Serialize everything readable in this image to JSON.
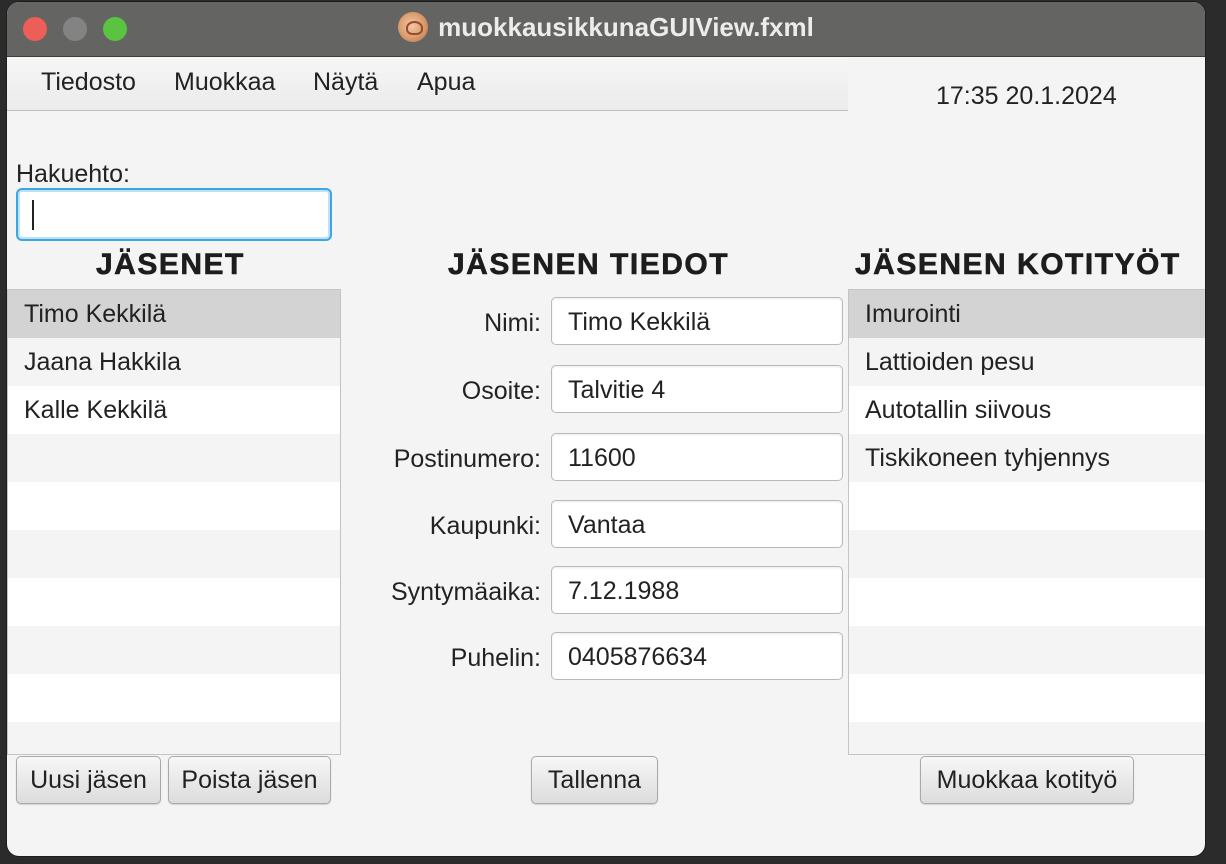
{
  "window": {
    "title": "muokkausikkunaGUIView.fxml",
    "app_icon": "app-icon"
  },
  "menu": {
    "items": [
      "Tiedosto",
      "Muokkaa",
      "Näytä",
      "Apua"
    ]
  },
  "clock": "17:35 20.1.2024",
  "search": {
    "label": "Hakuehto:",
    "value": "",
    "placeholder": ""
  },
  "members": {
    "heading": "JÄSENET",
    "items": [
      "Timo Kekkilä",
      "Jaana Hakkila",
      "Kalle Kekkilä"
    ],
    "selected_index": 0
  },
  "details": {
    "heading": "JÄSENEN TIEDOT",
    "fields": [
      {
        "label": "Nimi:",
        "value": "Timo Kekkilä"
      },
      {
        "label": "Osoite:",
        "value": "Talvitie 4"
      },
      {
        "label": "Postinumero:",
        "value": "11600"
      },
      {
        "label": "Kaupunki:",
        "value": "Vantaa"
      },
      {
        "label": "Syntymäaika:",
        "value": "7.12.1988"
      },
      {
        "label": "Puhelin:",
        "value": "0405876634"
      }
    ]
  },
  "chores": {
    "heading": "JÄSENEN KOTITYÖT",
    "items": [
      "Imurointi",
      "Lattioiden pesu",
      "Autotallin siivous",
      "Tiskikoneen tyhjennys"
    ],
    "selected_index": 0
  },
  "buttons": {
    "new_member": "Uusi jäsen",
    "delete_member": "Poista jäsen",
    "save": "Tallenna",
    "edit_chore": "Muokkaa kotityö"
  },
  "colors": {
    "focus_ring": "#3ba6e4",
    "close": "#ec5e57",
    "minimize": "#838383",
    "maximize": "#5ac33f"
  }
}
